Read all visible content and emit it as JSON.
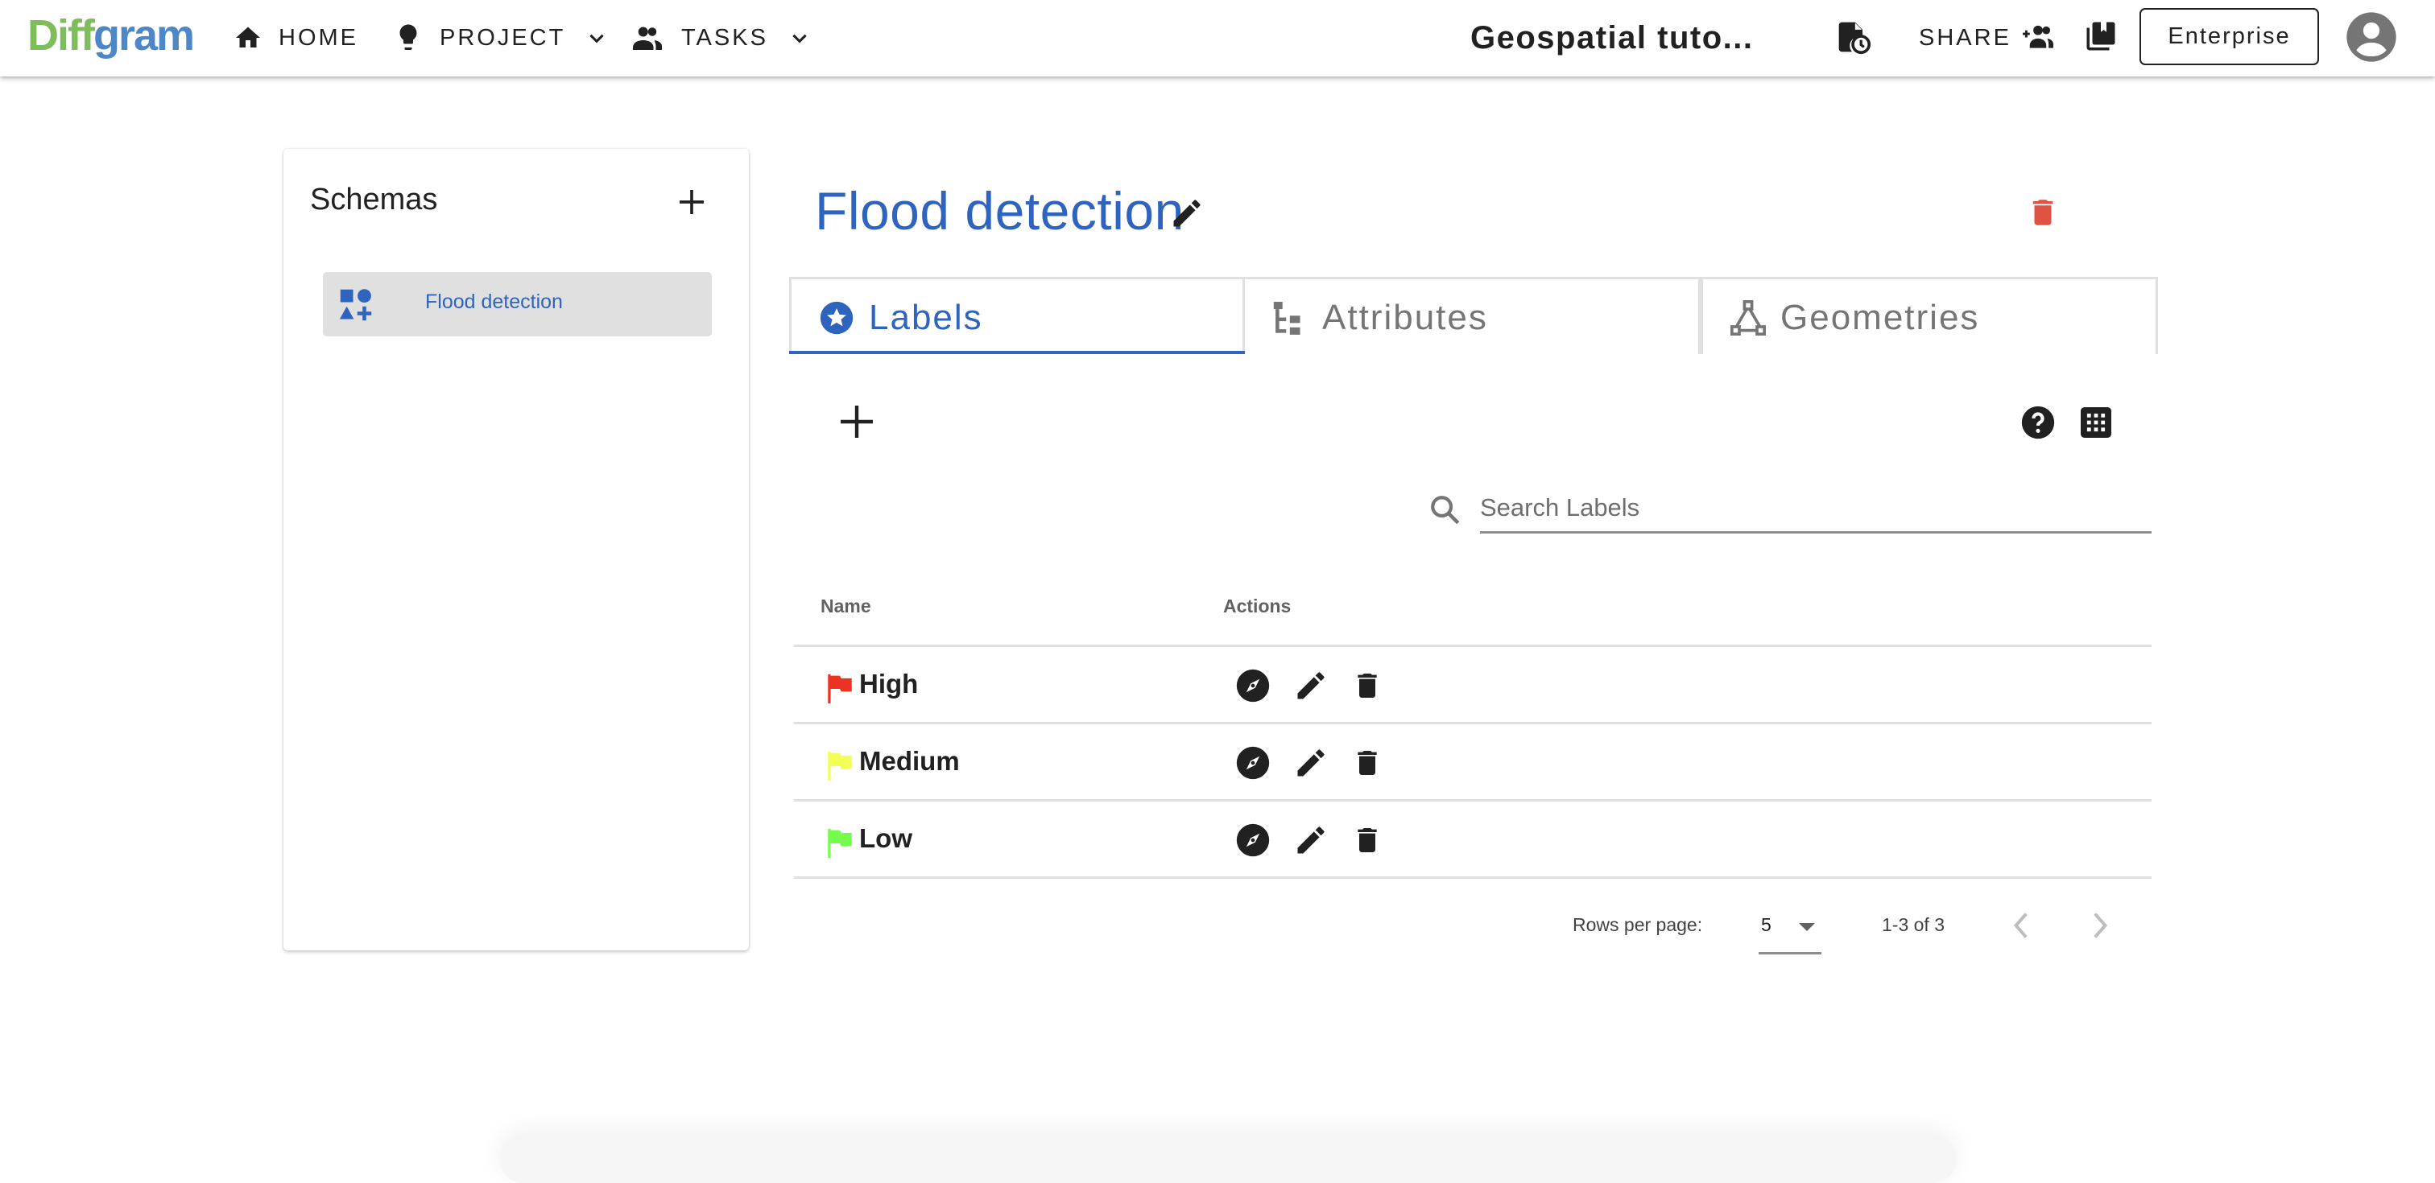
{
  "header": {
    "logo": {
      "part1": "Diff",
      "part2": "gram"
    },
    "nav": [
      {
        "label": "HOME",
        "icon": "home-icon"
      },
      {
        "label": "PROJECT",
        "icon": "lightbulb-icon",
        "dropdown": true
      },
      {
        "label": "TASKS",
        "icon": "people-icon",
        "dropdown": true
      }
    ],
    "project_name": "Geospatial tuto...",
    "share_label": "SHARE",
    "enterprise_label": "Enterprise"
  },
  "schemas_panel": {
    "title": "Schemas",
    "items": [
      {
        "label": "Flood detection",
        "selected": true
      }
    ]
  },
  "schema": {
    "title": "Flood detection",
    "tabs": [
      {
        "label": "Labels",
        "icon": "star-circle-icon",
        "active": true
      },
      {
        "label": "Attributes",
        "icon": "attribute-tree-icon",
        "active": false
      },
      {
        "label": "Geometries",
        "icon": "polygon-icon",
        "active": false
      }
    ],
    "search": {
      "placeholder": "Search Labels",
      "value": ""
    },
    "table": {
      "columns": [
        "Name",
        "Actions"
      ],
      "rows": [
        {
          "name": "High",
          "color": "#ea3323"
        },
        {
          "name": "Medium",
          "color": "#f2ff54"
        },
        {
          "name": "Low",
          "color": "#75fb4c"
        }
      ]
    },
    "pagination": {
      "rows_per_page_label": "Rows per page:",
      "rows_per_page": "5",
      "range": "1-3 of 3"
    }
  },
  "colors": {
    "accent": "#2f64be",
    "danger": "#e05241",
    "logo_green": "#7dbd5a",
    "logo_blue": "#4d87c7"
  }
}
